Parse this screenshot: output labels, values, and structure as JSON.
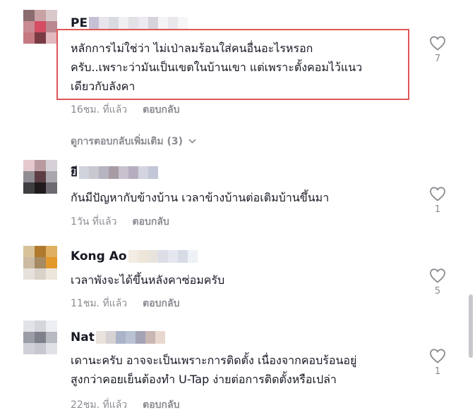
{
  "comments": [
    {
      "username": "PE",
      "text_lines": [
        "หลักการไม่ใช่ว่า ไม่เป่าลมร้อนใส่คนอื่นอะไรหรอก",
        "ครับ..เพราะว่ามันเป็นเขตในบ้านเขา แต่เพราะตั้งคอมไว้แนว",
        "เดียวกับลังคา"
      ],
      "time": "16ชม. ที่แล้ว",
      "reply_label": "ตอบกลับ",
      "likes": "7",
      "highlighted": true,
      "avatar_colors": [
        "#8a6b6e",
        "#c9a2a6",
        "#d9c9cb",
        "#c98a93",
        "#d44d63",
        "#b98890",
        "#c57a82",
        "#7a3a44",
        "#e1b9be"
      ],
      "name_blur_colors": [
        "#c7c0d4",
        "#e8e4ec",
        "#d8dbe2",
        "#f0eff2",
        "#e2e2e6",
        "#eceaf0",
        "#d7d3dc",
        "#f4f3f6",
        "#e9e7ec",
        "#f6f6f8"
      ]
    },
    {
      "username": "ยี",
      "text_lines": [
        "กันมีปัญหากับข้างบ้าน เวลาข้างบ้านต่อเติมบ้านขึ้นมา"
      ],
      "time": "1วัน ที่แล้ว",
      "reply_label": "ตอบกลับ",
      "likes": "1",
      "highlighted": false,
      "avatar_colors": [
        "#e6c9cf",
        "#b89aa0",
        "#d6d0d8",
        "#8f8d92",
        "#5c3d44",
        "#a9a6ad",
        "#3f3f42",
        "#1f1a1c",
        "#6d6b70"
      ],
      "name_blur_colors": [
        "#d0d2dc",
        "#c8c8d0",
        "#b7b4c2",
        "#a89ca4",
        "#c7c2ce",
        "#b6aebe",
        "#d3d4e0",
        "#c2c6d6"
      ]
    },
    {
      "username": "Kong Ao",
      "text_lines": [
        "เวลาพังจะได้ขึ้นหลังคาซ่อมครับ"
      ],
      "time": "11ชม. ที่แล้ว",
      "reply_label": "ตอบกลับ",
      "likes": "5",
      "highlighted": false,
      "avatar_colors": [
        "#d8c29a",
        "#b07a2e",
        "#e0b060",
        "#cbbba2",
        "#a58a62",
        "#e39a2a",
        "#e6e1da",
        "#d9d2c8",
        "#ece6dc"
      ],
      "name_blur_colors": [
        "#f3ece3",
        "#efe6da",
        "#e9e3dd",
        "#dcdde6",
        "#e4e7ef",
        "#d6dbe6",
        "#eef1f6"
      ]
    },
    {
      "username": "Nat",
      "text_lines": [
        "เดานะครับ อาจจะเป็นเพราะการติดตั้ง เนื่องจากคอบร้อนอยู่",
        "สูงกว่าคอยเย็นต้องทำ U-Tap ง่ายต่อการติดตั้งหรือเปล่า"
      ],
      "time": "22ชม. ที่แล้ว",
      "reply_label": "ตอบกลับ",
      "likes": "1",
      "highlighted": false,
      "avatar_colors": [
        "#e2e3e8",
        "#d5d6dc",
        "#eceef2",
        "#9a9ca6",
        "#7e808c",
        "#b8bac2",
        "#d0d1d8",
        "#c6c8d0",
        "#e0e1e6"
      ],
      "name_blur_colors": [
        "#e8e1dc",
        "#d6d2d4",
        "#a9b4c8",
        "#b8c2d2",
        "#a4a3b6",
        "#c9b7b4",
        "#e8d8cf"
      ]
    }
  ],
  "view_more_replies": "ดูการตอบกลับเพิ่มเติม (3)"
}
